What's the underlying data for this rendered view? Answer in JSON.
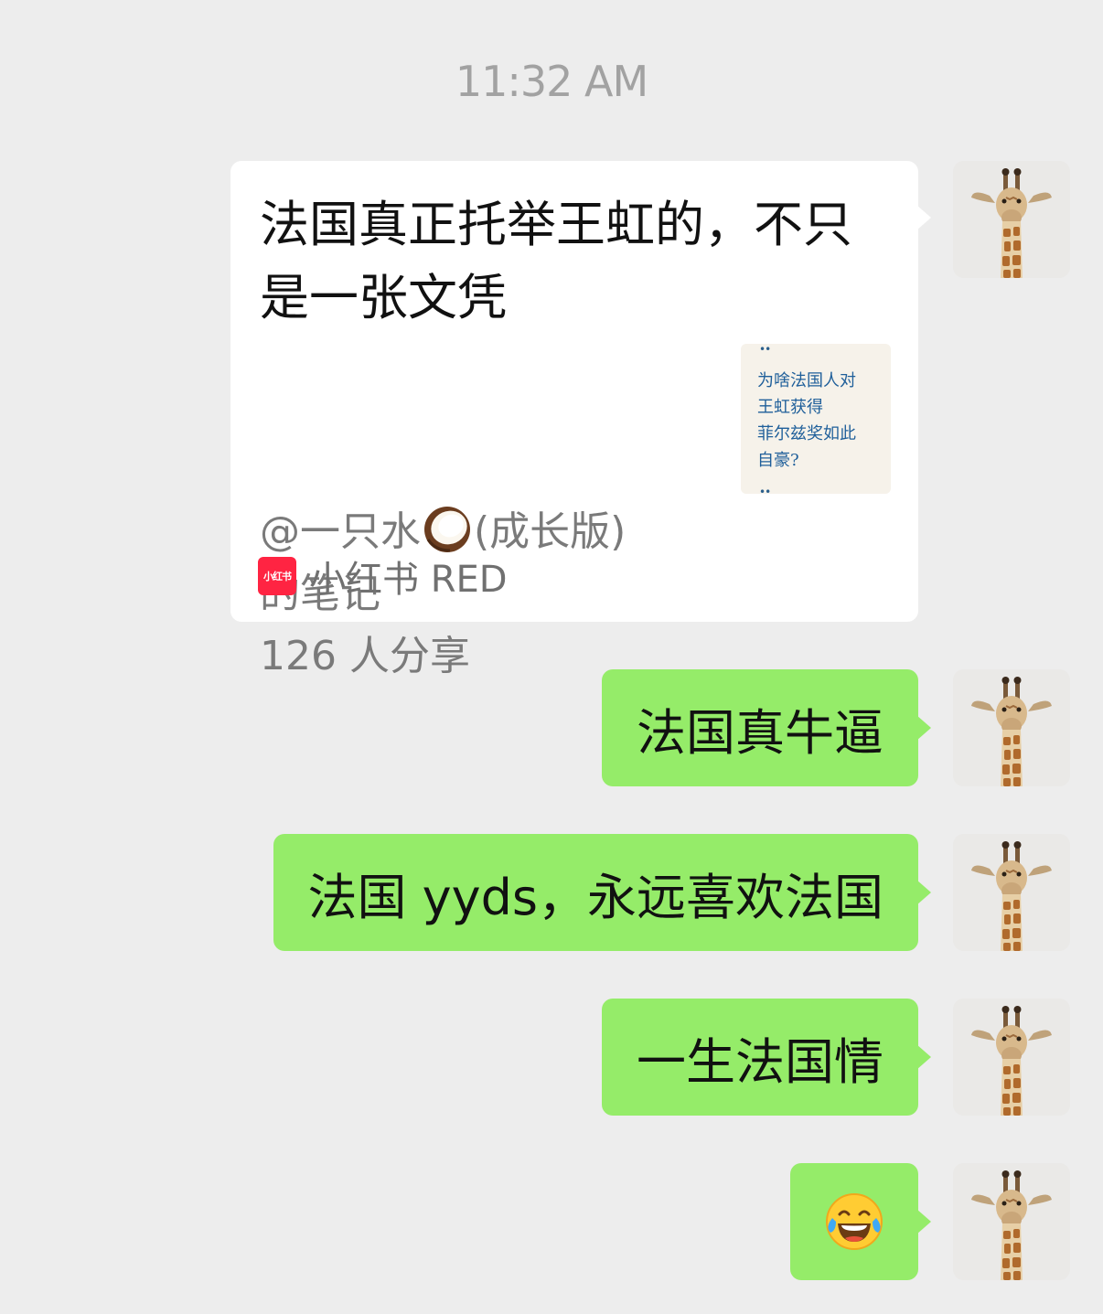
{
  "timestamp": "11:32 AM",
  "share_card": {
    "title": "法国真正托举王虹的，不只是一张文凭",
    "author_prefix": "@一只水",
    "author_emoji": "coconut-emoji",
    "author_suffix": "(成长版)",
    "note_label": "的笔记",
    "share_count": "126 人分享",
    "thumbnail_text": "为啥法国人对\n王虹获得\n菲尔兹奖如此\n自豪?",
    "source_logo_text": "小红书",
    "source_name": "小红书 RED",
    "source_color": "#ff2442"
  },
  "messages": [
    {
      "text": "法国真牛逼"
    },
    {
      "text": "法国 yyds，永远喜欢法国"
    },
    {
      "text": "一生法国情"
    },
    {
      "emoji": "tears-of-joy-emoji"
    }
  ],
  "colors": {
    "background": "#ededed",
    "bubble_sent": "#95ec69",
    "card": "#ffffff"
  },
  "avatar": "giraffe-avatar"
}
